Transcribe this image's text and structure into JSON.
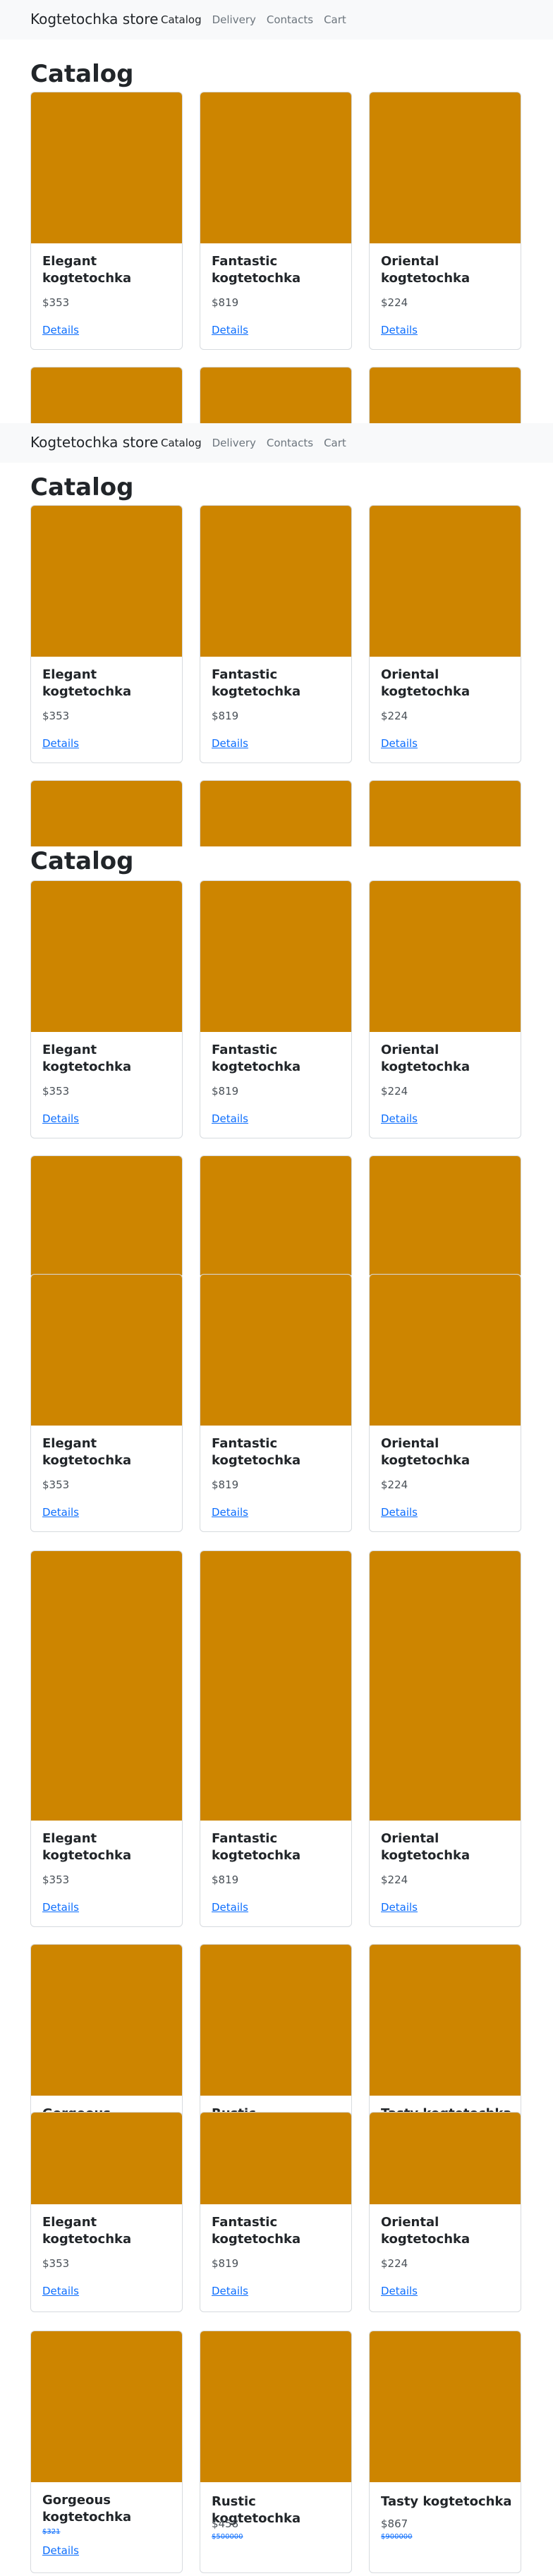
{
  "store": {
    "brand": "Kogtetochka store",
    "nav": [
      "Catalog",
      "Delivery",
      "Contacts",
      "Cart"
    ]
  },
  "catalog_title": "Catalog",
  "details_label": "Details",
  "products": [
    {
      "name": "Elegant kogtetochka",
      "price": "$353"
    },
    {
      "name": "Fantastic kogtetochka",
      "price": "$819"
    },
    {
      "name": "Oriental kogtetochka",
      "price": "$224"
    },
    {
      "name": "Gorgeous kogtetochka",
      "price": "",
      "old_price": "$321"
    },
    {
      "name": "Rustic kogtetochka",
      "price": "$458",
      "old_price": "$500000"
    },
    {
      "name": "Tasty kogtetochka",
      "price": "$867",
      "old_price": "$900000"
    }
  ],
  "colors": {
    "image_placeholder": "#cd8500",
    "link": "#0d6efd",
    "navbar": "#f8f9fa"
  }
}
